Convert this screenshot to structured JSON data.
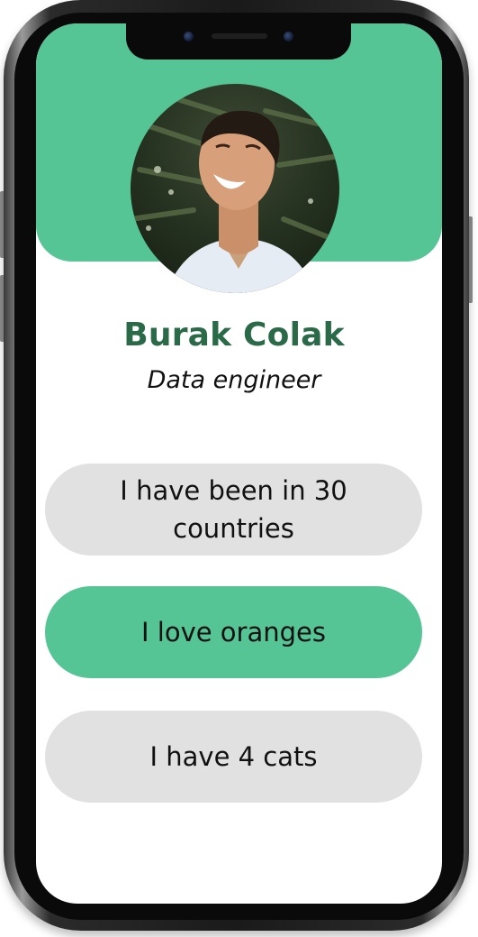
{
  "profile": {
    "name": "Burak Colak",
    "role": "Data engineer",
    "avatar_icon": "profile-photo"
  },
  "facts": [
    {
      "label": "I have been in 30 countries",
      "active": false
    },
    {
      "label": "I love oranges",
      "active": true
    },
    {
      "label": "I have 4 cats",
      "active": false
    }
  ],
  "colors": {
    "accent": "#56c596",
    "name_text": "#2a6a48",
    "pill_inactive": "#e1e1e1",
    "device": "#0a0a0a"
  }
}
